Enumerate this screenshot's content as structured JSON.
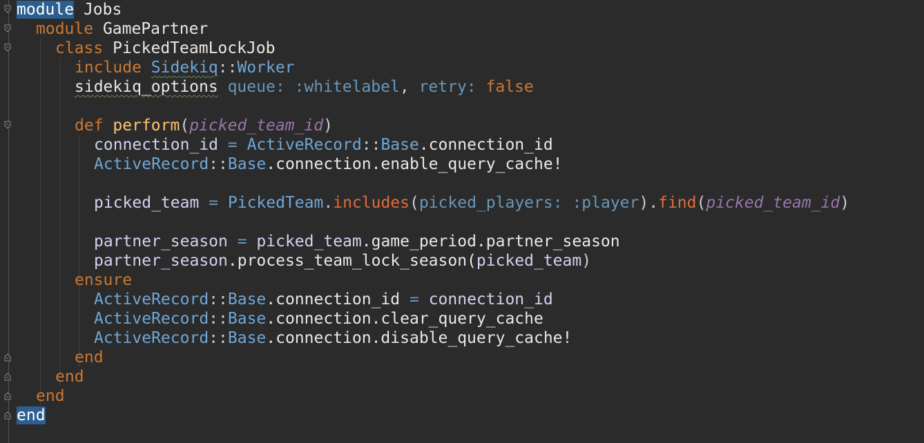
{
  "editor": {
    "language": "ruby",
    "colors": {
      "background": "#2b2b2b",
      "keyword": "#cc7832",
      "constant": "#6fa7d8",
      "method_name": "#ffc66d",
      "parameter": "#9876aa",
      "symbol": "#6897bb",
      "selection": "#2c5f91"
    },
    "tokens": {
      "l1": {
        "module": "module",
        "name": " Jobs"
      },
      "l2": {
        "module": "module",
        "name": " GamePartner"
      },
      "l3": {
        "class": "class",
        "name": " PickedTeamLockJob"
      },
      "l4": {
        "include": "include",
        "sp": " ",
        "sidekiq": "Sidekiq",
        "sep": "::",
        "worker": "Worker"
      },
      "l5": {
        "opts": "sidekiq_options",
        "sp1": " ",
        "queue": "queue:",
        "sp2": " ",
        "sym": ":whitelabel",
        "comma": ", ",
        "retry": "retry:",
        "sp3": " ",
        "false": "false"
      },
      "l7": {
        "def": "def",
        "sp": " ",
        "name": "perform",
        "open": "(",
        "param": "picked_team_id",
        "close": ")"
      },
      "l8": {
        "var": "connection_id",
        "eq": " = ",
        "ar": "ActiveRecord",
        "sep": "::",
        "base": "Base",
        "rest": ".connection_id"
      },
      "l9": {
        "ar": "ActiveRecord",
        "sep": "::",
        "base": "Base",
        "rest": ".connection.enable_query_cache!"
      },
      "l11": {
        "var": "picked_team",
        "eq": " = ",
        "pt": "PickedTeam",
        "dot1": ".",
        "includes": "includes",
        "open1": "(",
        "arg": "picked_players:",
        "sp": " ",
        "sym": ":player",
        "close1": ")",
        "dot2": ".",
        "find": "find",
        "open2": "(",
        "param": "picked_team_id",
        "close2": ")"
      },
      "l13": {
        "var": "partner_season",
        "eq": " = ",
        "rhs": "picked_team",
        "rest": ".game_period.partner_season"
      },
      "l14": {
        "var": "partner_season",
        "rest": ".process_team_lock_season(",
        "arg": "picked_team",
        "close": ")"
      },
      "l15": {
        "ensure": "ensure"
      },
      "l16": {
        "ar": "ActiveRecord",
        "sep": "::",
        "base": "Base",
        "rest": ".connection_id",
        "eq": " = ",
        "var": "connection_id"
      },
      "l17": {
        "ar": "ActiveRecord",
        "sep": "::",
        "base": "Base",
        "rest": ".connection.clear_query_cache"
      },
      "l18": {
        "ar": "ActiveRecord",
        "sep": "::",
        "base": "Base",
        "rest": ".connection.disable_query_cache!"
      },
      "l19": {
        "end": "end"
      },
      "l20": {
        "end": "end"
      },
      "l21": {
        "end": "end"
      },
      "l22": {
        "end": "end"
      }
    }
  }
}
